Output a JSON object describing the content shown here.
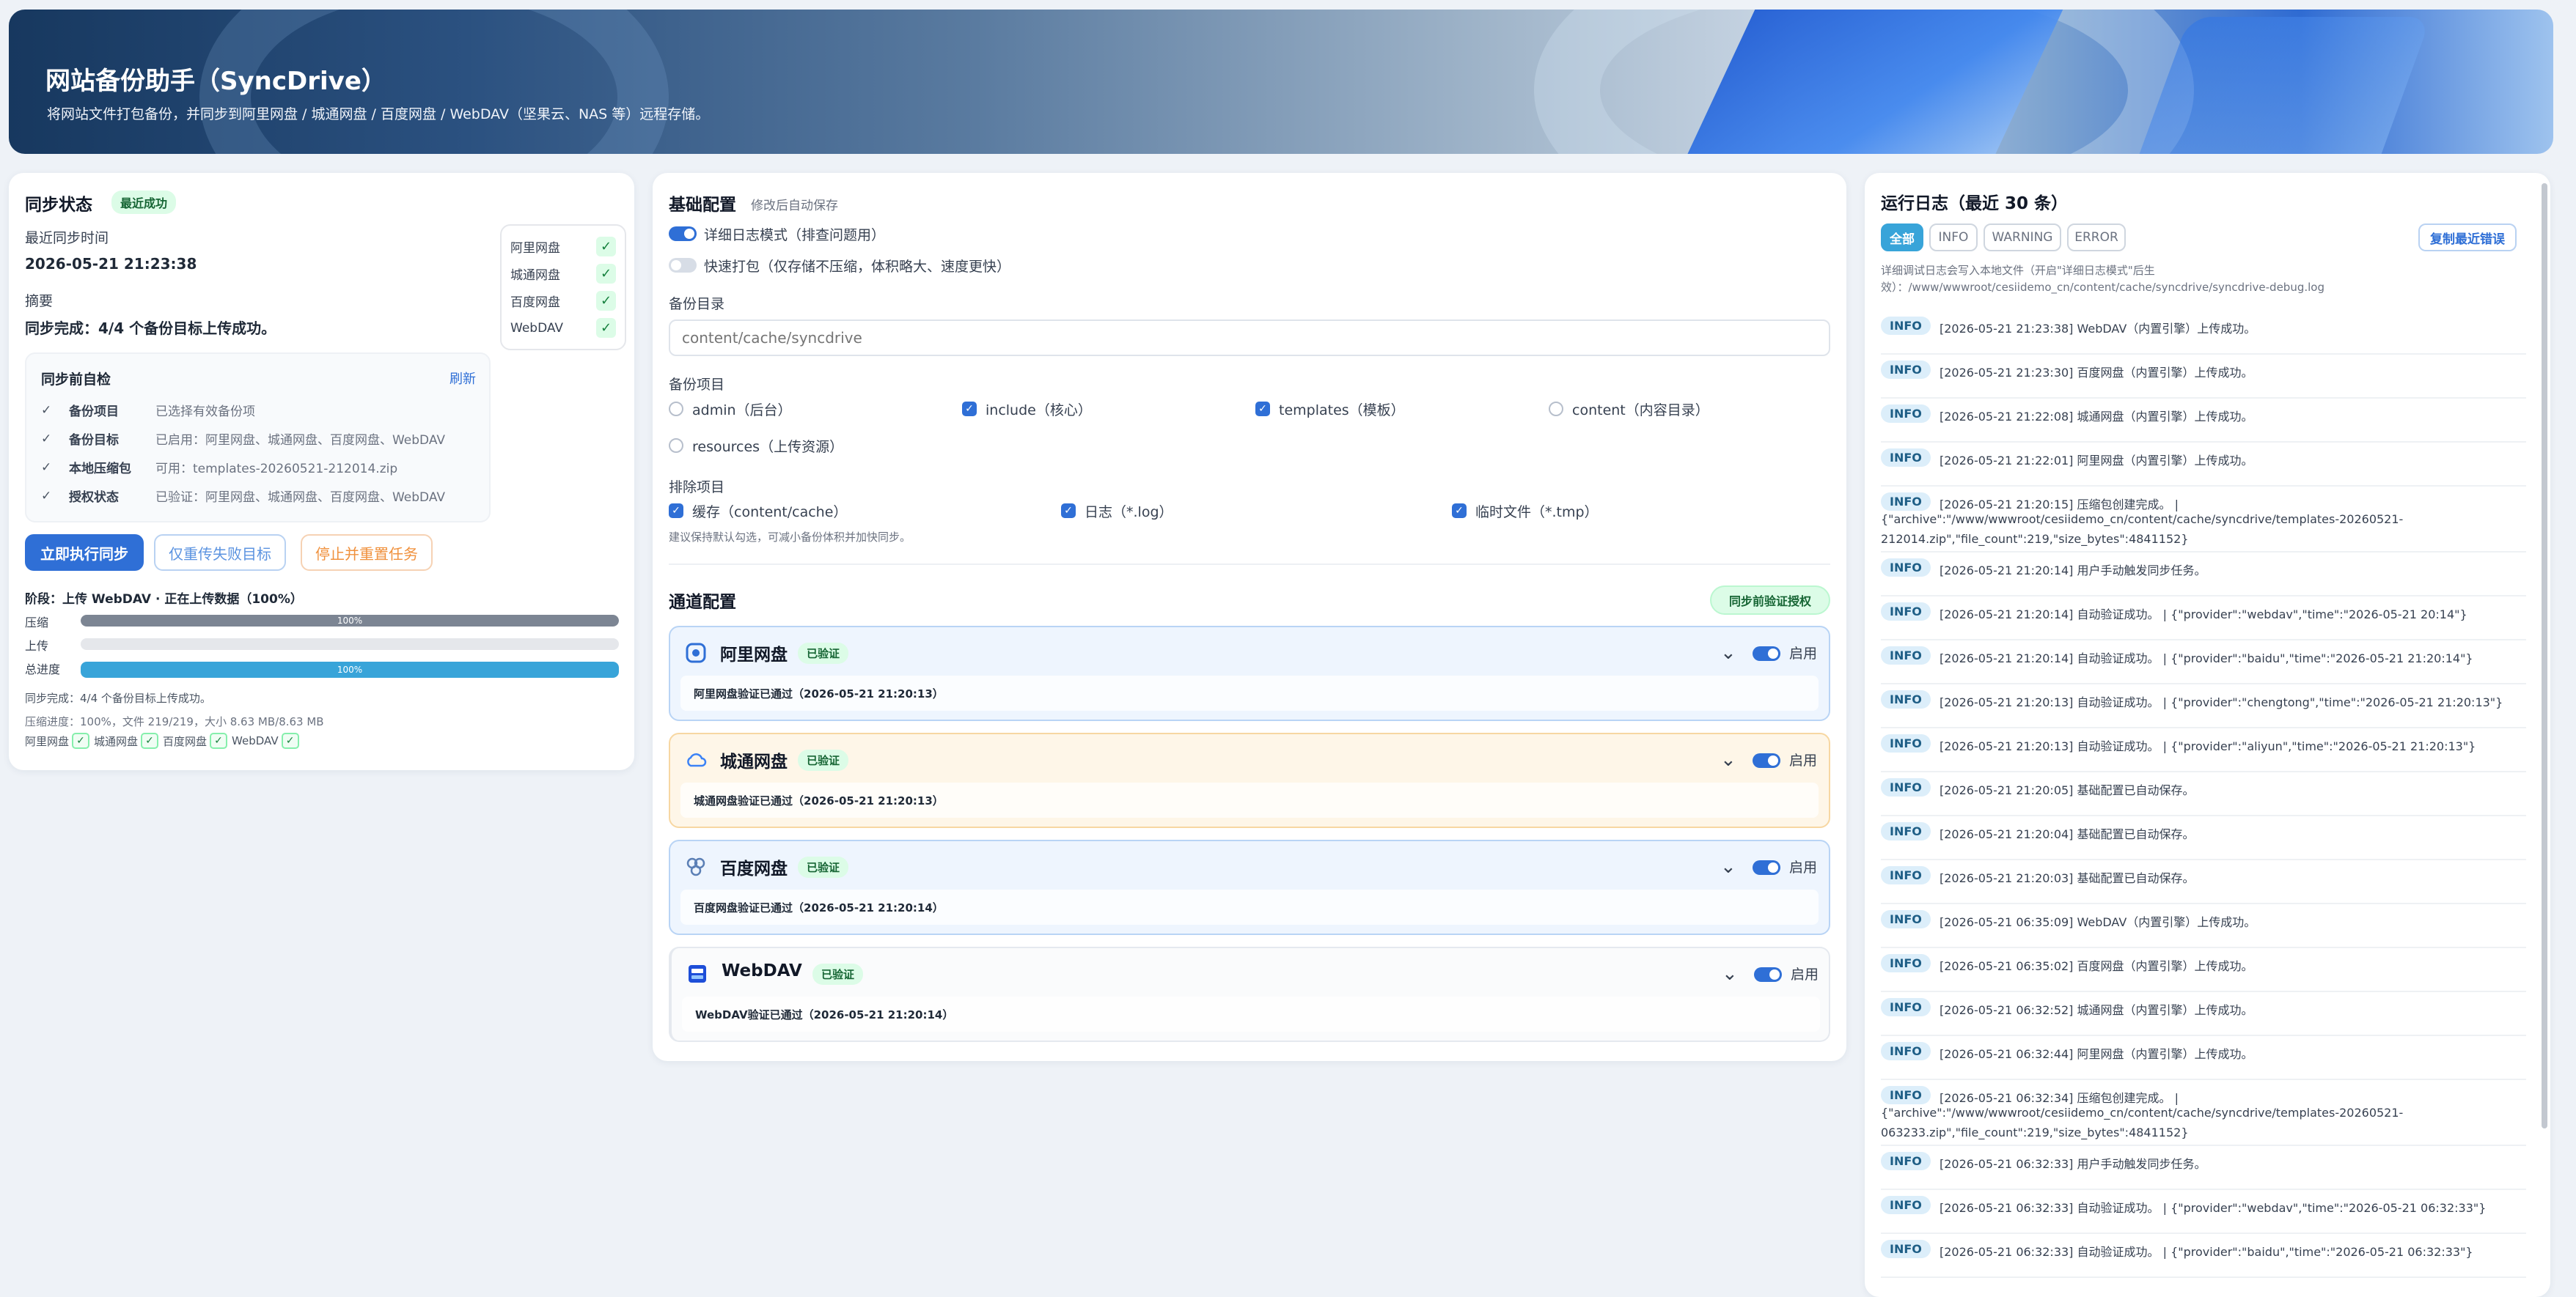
{
  "header": {
    "title": "网站备份助手（SyncDrive）",
    "subtitle": "将网站文件打包备份，并同步到阿里网盘 / 城通网盘 / 百度网盘 / WebDAV（坚果云、NAS 等）远程存储。"
  },
  "sync_status": {
    "title": "同步状态",
    "badge": "最近成功",
    "last_sync_label": "最近同步时间",
    "last_sync_value": "2026-05-21 21:23:38",
    "summary_label": "摘要",
    "summary_value": "同步完成：4/4 个备份目标上传成功。",
    "targets": [
      {
        "name": "阿里网盘",
        "check": "✓"
      },
      {
        "name": "城通网盘",
        "check": "✓"
      },
      {
        "name": "百度网盘",
        "check": "✓"
      },
      {
        "name": "WebDAV",
        "check": "✓"
      }
    ],
    "precheck": {
      "title": "同步前自检",
      "refresh": "刷新",
      "rows": [
        {
          "check": "✓",
          "label": "备份项目",
          "value": "已选择有效备份项"
        },
        {
          "check": "✓",
          "label": "备份目标",
          "value": "已启用：阿里网盘、城通网盘、百度网盘、WebDAV"
        },
        {
          "check": "✓",
          "label": "本地压缩包",
          "value": "可用：templates-20260521-212014.zip"
        },
        {
          "check": "✓",
          "label": "授权状态",
          "value": "已验证：阿里网盘、城通网盘、百度网盘、WebDAV"
        }
      ]
    },
    "buttons": {
      "run": "立即执行同步",
      "retry": "仅重传失败目标",
      "stop": "停止并重置任务"
    },
    "stage": "阶段：上传 WebDAV · 正在上传数据（100%）",
    "progress": [
      {
        "label": "压缩",
        "value": 100,
        "text": "100%",
        "color": "#7c8593"
      },
      {
        "label": "上传",
        "value": 0,
        "text": "",
        "color": "#38a4d9"
      },
      {
        "label": "总进度",
        "value": 100,
        "text": "100%",
        "color": "#38a4d9"
      }
    ],
    "result_line": "同步完成：4/4 个备份目标上传成功。",
    "compress_line": "压缩进度：100%，文件 219/219，大小 8.63 MB/8.63 MB",
    "mini_targets": [
      "阿里网盘",
      "城通网盘",
      "百度网盘",
      "WebDAV"
    ],
    "mini_check": "✓"
  },
  "basic_config": {
    "title": "基础配置",
    "hint": "修改后自动保存",
    "verbose_log": {
      "label": "详细日志模式（排查问题用）",
      "on": true
    },
    "fast_pack": {
      "label": "快速打包（仅存储不压缩，体积略大、速度更快）",
      "on": false
    },
    "backup_dir_label": "备份目录",
    "backup_dir_placeholder": "content/cache/syncdrive",
    "backup_items_label": "备份项目",
    "backup_items": [
      {
        "label": "admin（后台）",
        "checked": false
      },
      {
        "label": "include（核心）",
        "checked": true
      },
      {
        "label": "templates（模板）",
        "checked": true
      },
      {
        "label": "content（内容目录）",
        "checked": false
      },
      {
        "label": "resources（上传资源）",
        "checked": false
      }
    ],
    "exclude_label": "排除项目",
    "exclude_items": [
      {
        "label": "缓存（content/cache）",
        "checked": true
      },
      {
        "label": "日志（*.log）",
        "checked": true
      },
      {
        "label": "临时文件（*.tmp）",
        "checked": true
      }
    ],
    "exclude_hint": "建议保持默认勾选，可减小备份体积并加快同步。"
  },
  "channels": {
    "title": "通道配置",
    "verify_button": "同步前验证授权",
    "enable_label": "启用",
    "items": [
      {
        "name": "阿里网盘",
        "badge": "已验证",
        "status": "阿里网盘验证已通过（2026-05-21 21:20:13）",
        "icon": "aliyun-icon",
        "bg": "#eef5fe",
        "border": "#b9d4f5",
        "icon_color": "#2f6fd6"
      },
      {
        "name": "城通网盘",
        "badge": "已验证",
        "status": "城通网盘验证已通过（2026-05-21 21:20:13）",
        "icon": "cloud-icon",
        "bg": "#fef6e8",
        "border": "#f7d7a2",
        "icon_color": "#3b82f6"
      },
      {
        "name": "百度网盘",
        "badge": "已验证",
        "status": "百度网盘验证已通过（2026-05-21 21:20:14）",
        "icon": "baidu-icon",
        "bg": "#eef5fe",
        "border": "#b9d4f5",
        "icon_color": "#5b7fb5"
      },
      {
        "name": "WebDAV",
        "badge": "已验证",
        "status": "WebDAV验证已通过（2026-05-21 21:20:14）",
        "icon": "webdav-icon",
        "bg": "#fafbfc",
        "border": "#e5e9ef",
        "icon_color": "#1d4ed8"
      }
    ]
  },
  "log": {
    "title": "运行日志（最近 30 条）",
    "filters": [
      "全部",
      "INFO",
      "WARNING",
      "ERROR"
    ],
    "copy_button": "复制最近错误",
    "note_line1": "详细调试日志会写入本地文件（开启\"详细日志模式\"后生",
    "note_line2": "效）：/www/wwwroot/cesiidemo_cn/content/cache/syncdrive/syncdrive-debug.log",
    "entries": [
      {
        "level": "INFO",
        "text": "[2026-05-21 21:23:38] WebDAV（内置引擎）上传成功。"
      },
      {
        "level": "INFO",
        "text": "[2026-05-21 21:23:30] 百度网盘（内置引擎）上传成功。"
      },
      {
        "level": "INFO",
        "text": "[2026-05-21 21:22:08] 城通网盘（内置引擎）上传成功。"
      },
      {
        "level": "INFO",
        "text": "[2026-05-21 21:22:01] 阿里网盘（内置引擎）上传成功。"
      },
      {
        "level": "INFO",
        "text": "[2026-05-21 21:20:15] 压缩包创建完成。 |",
        "cont1": "{\"archive\":\"/www/wwwroot/cesiidemo_cn/content/cache/syncdrive/templates-20260521-",
        "cont2": "212014.zip\",\"file_count\":219,\"size_bytes\":4841152}"
      },
      {
        "level": "INFO",
        "text": "[2026-05-21 21:20:14] 用户手动触发同步任务。"
      },
      {
        "level": "INFO",
        "text": "[2026-05-21 21:20:14] 自动验证成功。 | {\"provider\":\"webdav\",\"time\":\"2026-05-21 20:14\"}"
      },
      {
        "level": "INFO",
        "text": "[2026-05-21 21:20:14] 自动验证成功。 | {\"provider\":\"baidu\",\"time\":\"2026-05-21 21:20:14\"}"
      },
      {
        "level": "INFO",
        "text": "[2026-05-21 21:20:13] 自动验证成功。 | {\"provider\":\"chengtong\",\"time\":\"2026-05-21 21:20:13\"}"
      },
      {
        "level": "INFO",
        "text": "[2026-05-21 21:20:13] 自动验证成功。 | {\"provider\":\"aliyun\",\"time\":\"2026-05-21 21:20:13\"}"
      },
      {
        "level": "INFO",
        "text": "[2026-05-21 21:20:05] 基础配置已自动保存。"
      },
      {
        "level": "INFO",
        "text": "[2026-05-21 21:20:04] 基础配置已自动保存。"
      },
      {
        "level": "INFO",
        "text": "[2026-05-21 21:20:03] 基础配置已自动保存。"
      },
      {
        "level": "INFO",
        "text": "[2026-05-21 06:35:09] WebDAV（内置引擎）上传成功。"
      },
      {
        "level": "INFO",
        "text": "[2026-05-21 06:35:02] 百度网盘（内置引擎）上传成功。"
      },
      {
        "level": "INFO",
        "text": "[2026-05-21 06:32:52] 城通网盘（内置引擎）上传成功。"
      },
      {
        "level": "INFO",
        "text": "[2026-05-21 06:32:44] 阿里网盘（内置引擎）上传成功。"
      },
      {
        "level": "INFO",
        "text": "[2026-05-21 06:32:34] 压缩包创建完成。 |",
        "cont1": "{\"archive\":\"/www/wwwroot/cesiidemo_cn/content/cache/syncdrive/templates-20260521-",
        "cont2": "063233.zip\",\"file_count\":219,\"size_bytes\":4841152}"
      },
      {
        "level": "INFO",
        "text": "[2026-05-21 06:32:33] 用户手动触发同步任务。"
      },
      {
        "level": "INFO",
        "text": "[2026-05-21 06:32:33] 自动验证成功。 | {\"provider\":\"webdav\",\"time\":\"2026-05-21 06:32:33\"}"
      },
      {
        "level": "INFO",
        "text": "[2026-05-21 06:32:33] 自动验证成功。 | {\"provider\":\"baidu\",\"time\":\"2026-05-21 06:32:33\"}"
      }
    ]
  }
}
